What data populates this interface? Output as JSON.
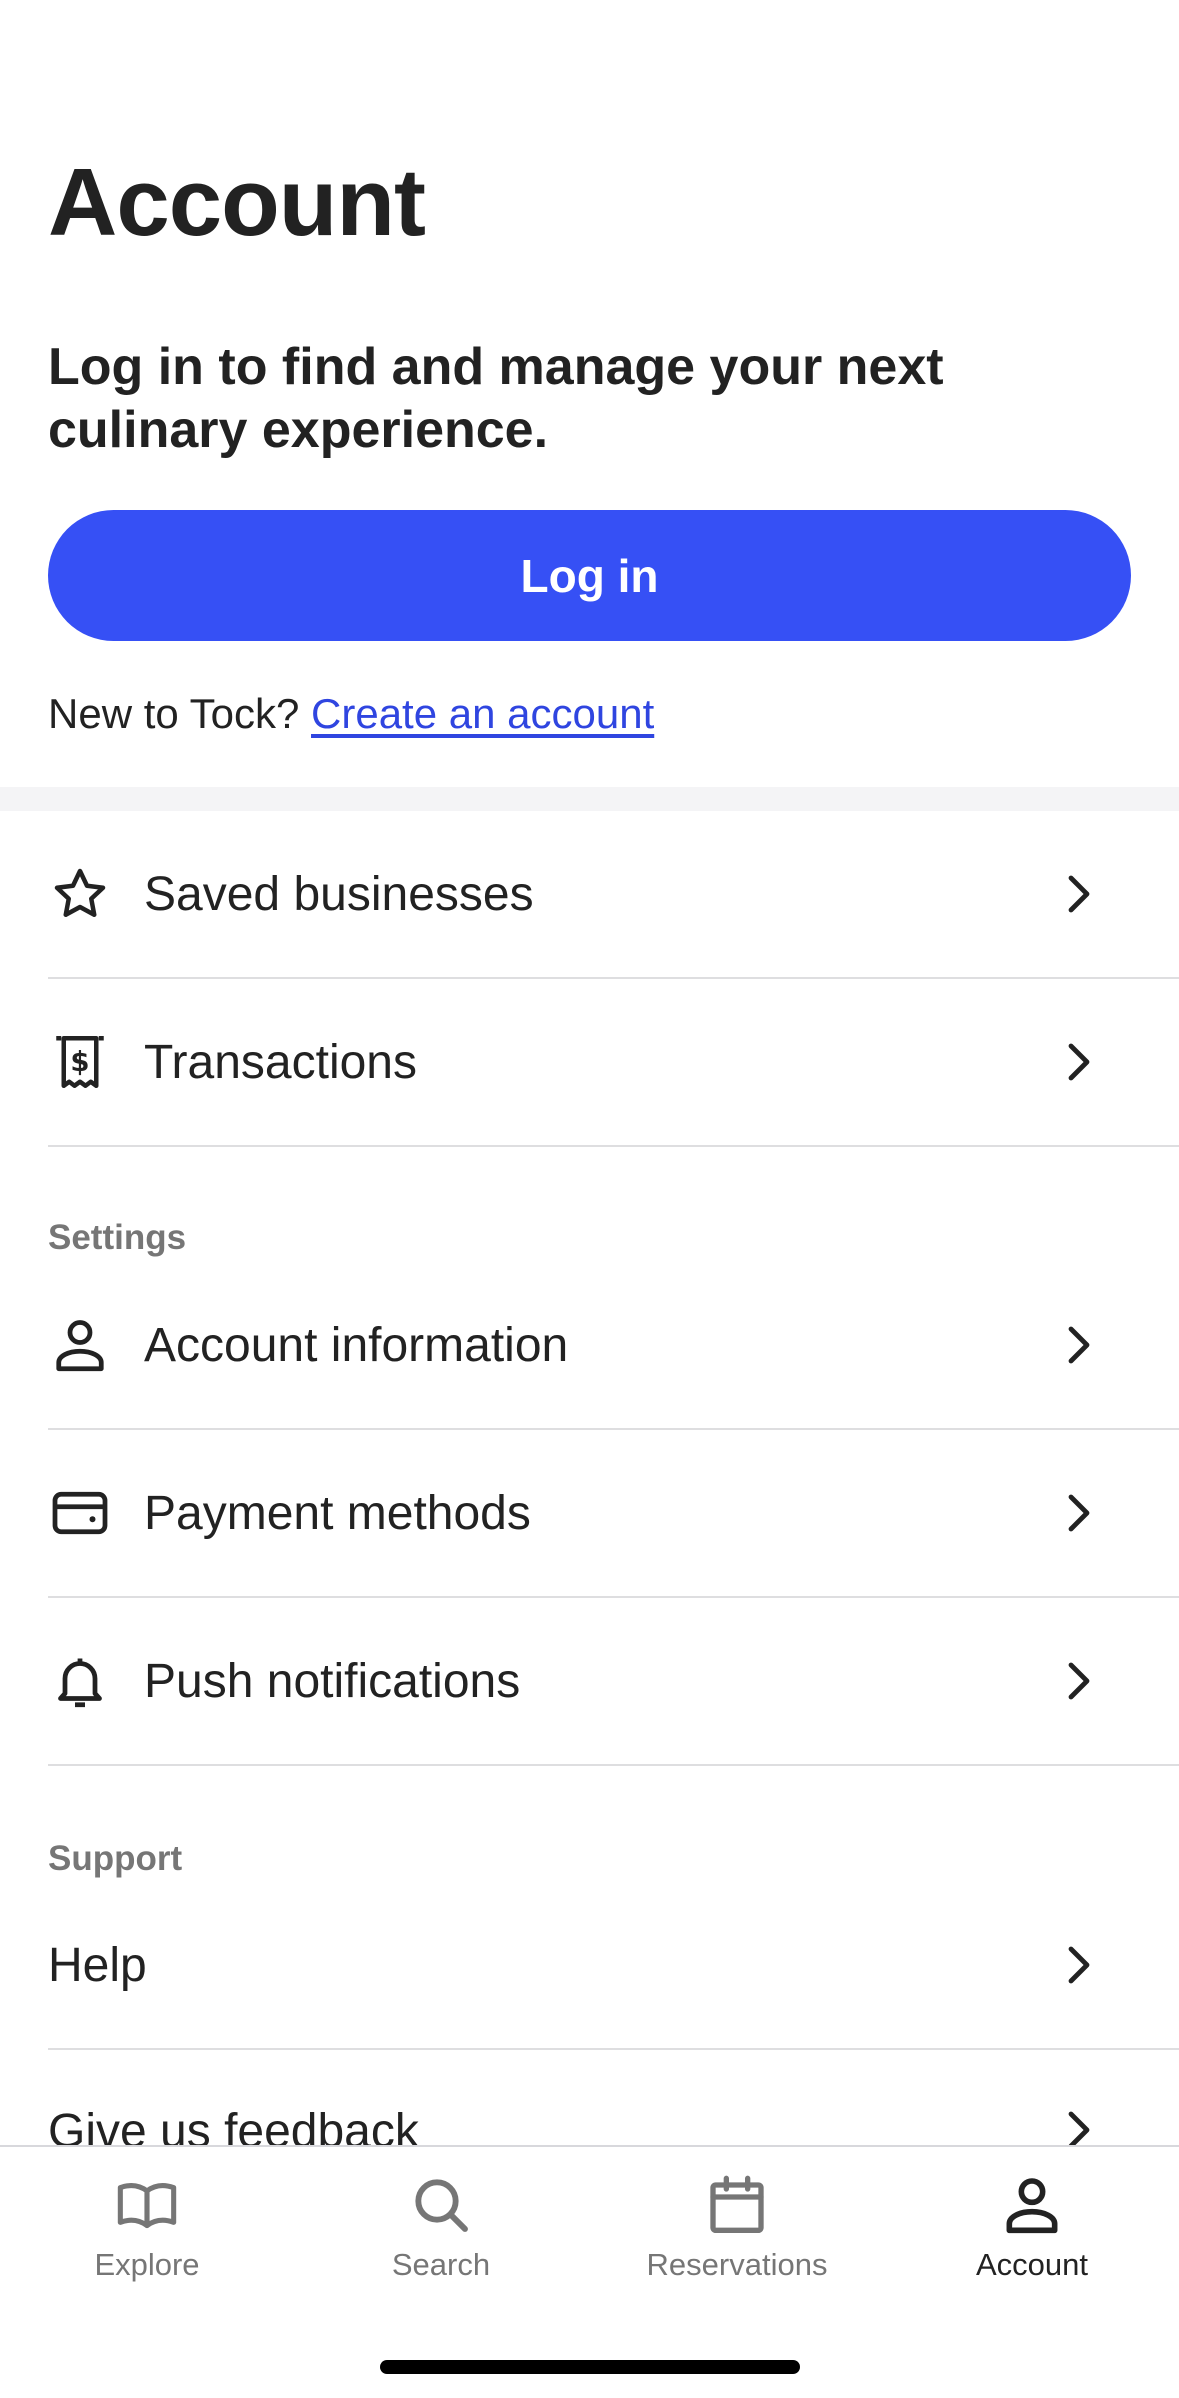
{
  "header": {
    "title": "Account"
  },
  "intro": {
    "text": "Log in to find and manage your next culinary experience.",
    "login_label": "Log in",
    "signup_prompt": "New to Tock?",
    "signup_link": "Create an account"
  },
  "account_items": [
    {
      "label": "Saved businesses",
      "icon": "star-icon"
    },
    {
      "label": "Transactions",
      "icon": "receipt-icon"
    }
  ],
  "settings": {
    "heading": "Settings",
    "items": [
      {
        "label": "Account information",
        "icon": "person-icon"
      },
      {
        "label": "Payment methods",
        "icon": "credit-card-icon"
      },
      {
        "label": "Push notifications",
        "icon": "bell-icon"
      }
    ]
  },
  "support": {
    "heading": "Support",
    "items": [
      {
        "label": "Help"
      },
      {
        "label": "Give us feedback"
      }
    ]
  },
  "tab_bar": {
    "tabs": [
      {
        "label": "Explore",
        "icon": "book-icon",
        "active": false
      },
      {
        "label": "Search",
        "icon": "search-icon",
        "active": false
      },
      {
        "label": "Reservations",
        "icon": "calendar-icon",
        "active": false
      },
      {
        "label": "Account",
        "icon": "person-icon",
        "active": true
      }
    ]
  },
  "colors": {
    "accent": "#3650f5",
    "link": "#2f45e0",
    "text": "#222222",
    "muted": "#767676",
    "divider": "#dedee0"
  }
}
